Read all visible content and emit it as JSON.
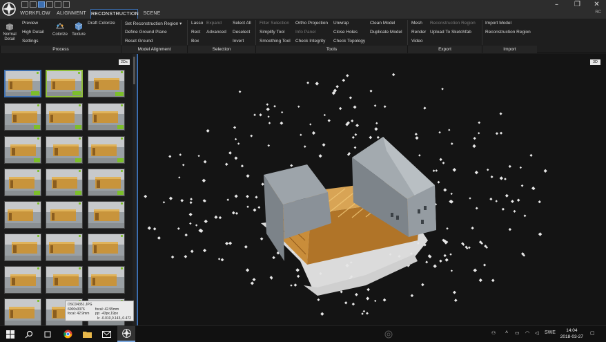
{
  "app": {
    "badge": "RC"
  },
  "tabs": [
    "WORKFLOW",
    "ALIGNMENT",
    "RECONSTRUCTION",
    "SCENE"
  ],
  "ribbon": {
    "process": {
      "normal_detail": "Normal Detail",
      "preview": "Preview",
      "high_detail": "High Detail",
      "settings": "Settings",
      "colorize": "Colorize",
      "texture": "Texture",
      "draft_colorize": "Draft Colorize",
      "group": "Process"
    },
    "model_alignment": {
      "set_region": "Set Reconstruction Region",
      "define_ground": "Define Ground Plane",
      "reset_ground": "Reset Ground",
      "group": "Model Alignment"
    },
    "selection": {
      "lasso": "Lasso",
      "expand": "Expand",
      "select_all": "Select All",
      "rect": "Rect",
      "advanced": "Advanced",
      "deselect": "Deselect",
      "box": "Box",
      "invert": "Invert",
      "group": "Selection"
    },
    "tools": {
      "filter_selection": "Filter Selection",
      "ortho_projection": "Ortho Projection",
      "unwrap": "Unwrap",
      "clean_model": "Clean Model",
      "simplify_tool": "Simplify Tool",
      "info_panel": "Info Panel",
      "close_holes": "Close Holes",
      "duplicate_model": "Duplicate Model",
      "smoothing_tool": "Smoothing Tool",
      "check_integrity": "Check Integrity",
      "check_topology": "Check Topology",
      "group": "Tools"
    },
    "export": {
      "mesh": "Mesh",
      "reconstruction_region": "Reconstruction Region",
      "render": "Render",
      "upload_sketchfab": "Upload To Sketchfab",
      "video": "Video",
      "group": "Export"
    },
    "import": {
      "import_model": "Import Model",
      "reconstruction_region": "Reconstruction Region",
      "group": "Import"
    }
  },
  "panels": {
    "left_label": "2Ds",
    "view_label": "3D"
  },
  "thumbnail_tags": [
    "T005",
    "T11",
    "T11",
    "T11",
    "T11",
    "T11",
    "T1",
    "T1",
    "T1",
    "T",
    "T",
    "T"
  ],
  "tooltip": {
    "filename": "DSC04351.JPG",
    "resolution": "6000x3376",
    "focal1": "focal: 42.95mm",
    "focal2": "focal: 42.9mm",
    "pp": "pp: -43px,19px",
    "k": "k: -0.010,0.143,-0.472"
  },
  "taskbar": {
    "language": "SWE",
    "time": "14:04",
    "date": "2018-03-27"
  },
  "icons": [
    "app-logo-icon",
    "windows-start-icon",
    "search-icon",
    "task-view-icon",
    "chrome-icon",
    "file-explorer-icon",
    "mail-icon",
    "reality-capture-icon",
    "notification-icon"
  ]
}
